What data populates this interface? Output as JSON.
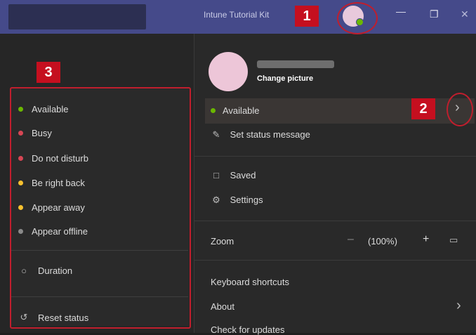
{
  "titlebar": {
    "title": "Intune Tutorial Kit"
  },
  "annotations": [
    "1",
    "2",
    "3"
  ],
  "status_menu": {
    "items": [
      {
        "label": "Available",
        "color": "#6bb700"
      },
      {
        "label": "Busy",
        "color": "#d74654"
      },
      {
        "label": "Do not disturb",
        "color": "#d74654"
      },
      {
        "label": "Be right back",
        "color": "#f8c12f"
      },
      {
        "label": "Appear away",
        "color": "#f8c12f"
      },
      {
        "label": "Appear offline",
        "color": "#8a8a8a"
      }
    ],
    "duration": "Duration",
    "reset": "Reset status"
  },
  "profile": {
    "change_picture": "Change picture",
    "status": "Available",
    "status_color": "#6bb700",
    "set_status_message": "Set status message",
    "saved": "Saved",
    "settings": "Settings",
    "zoom_label": "Zoom",
    "zoom_value": "(100%)",
    "keyboard_shortcuts": "Keyboard shortcuts",
    "about": "About",
    "check_updates": "Check for updates"
  }
}
